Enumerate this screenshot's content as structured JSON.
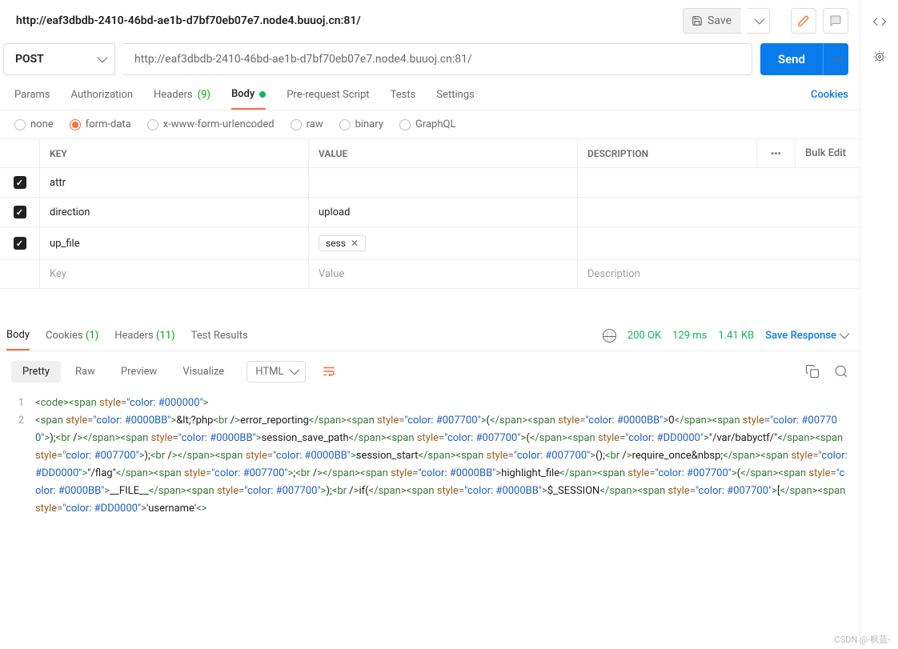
{
  "header": {
    "title": "http://eaf3dbdb-2410-46bd-ae1b-d7bf70eb07e7.node4.buuoj.cn:81/",
    "save_label": "Save"
  },
  "request": {
    "method": "POST",
    "url": "http://eaf3dbdb-2410-46bd-ae1b-d7bf70eb07e7.node4.buuoj.cn:81/",
    "send_label": "Send"
  },
  "req_tabs": {
    "params": "Params",
    "auth": "Authorization",
    "headers": "Headers",
    "headers_count": "(9)",
    "body": "Body",
    "prescript": "Pre-request Script",
    "tests": "Tests",
    "settings": "Settings",
    "cookies": "Cookies"
  },
  "body_types": {
    "none": "none",
    "form": "form-data",
    "xform": "x-www-form-urlencoded",
    "raw": "raw",
    "binary": "binary",
    "graphql": "GraphQL"
  },
  "form": {
    "head_key": "KEY",
    "head_value": "VALUE",
    "head_desc": "DESCRIPTION",
    "bulk": "Bulk Edit",
    "rows": [
      {
        "key": "attr",
        "value": "",
        "desc": ""
      },
      {
        "key": "direction",
        "value": "upload",
        "desc": ""
      },
      {
        "key": "up_file",
        "file": "sess",
        "desc": ""
      }
    ],
    "ph_key": "Key",
    "ph_value": "Value",
    "ph_desc": "Description"
  },
  "resp_tabs": {
    "body": "Body",
    "cookies": "Cookies",
    "cookies_count": "(1)",
    "headers": "Headers",
    "headers_count": "(11)",
    "tests": "Test Results"
  },
  "status": {
    "code": "200 OK",
    "time": "129 ms",
    "size": "1.41 KB",
    "save": "Save Response"
  },
  "viewmodes": {
    "pretty": "Pretty",
    "raw": "Raw",
    "preview": "Preview",
    "visualize": "Visualize",
    "lang": "HTML"
  },
  "code_lines": [
    "<code><span style=\"color: #000000\">",
    "<span style=\"color: #0000BB\">&lt;?php<br />error_reporting</span><span style=\"color: #007700\">(</span><span style=\"color: #0000BB\">0</span><span style=\"color: #007700\">);<br /></span><span style=\"color: #0000BB\">session_save_path</span><span style=\"color: #007700\">(</span><span style=\"color: #DD0000\">\"/var/babyctf/\"</span><span style=\"color: #007700\">);<br /></span><span style=\"color: #0000BB\">session_start</span><span style=\"color: #007700\">();<br />require_once&nbsp;</span><span style=\"color: #DD0000\">\"/flag\"</span><span style=\"color: #007700\">;<br /></span><span style=\"color: #0000BB\">highlight_file</span><span style=\"color: #007700\">(</span><span style=\"color: #0000BB\">__FILE__</span><span style=\"color: #007700\">);<br />if(</span><span style=\"color: #0000BB\">$_SESSION</span><span style=\"color: #007700\">[</span><span style=\"color: #DD0000\">'username'</"
  ],
  "watermark": "CSDN @-枫蓝-"
}
